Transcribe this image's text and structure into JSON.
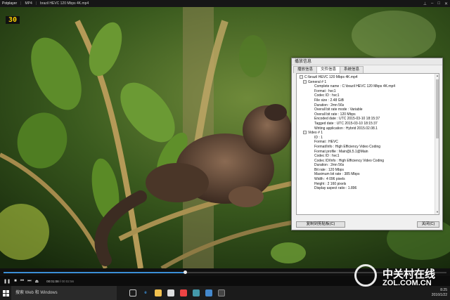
{
  "player": {
    "logo": "Potplayer",
    "format": "MP4",
    "file_title": "brazil HEVC 120 Mbps 4K.mp4",
    "fps_overlay": "30"
  },
  "dialog": {
    "title": "播放信息",
    "tabs": [
      {
        "label": "播放信息",
        "active": false
      },
      {
        "label": "文件信息",
        "active": true
      },
      {
        "label": "系统信息",
        "active": false
      }
    ],
    "root": "C:\\brazil HEVC 120 Mbps 4K.mp4",
    "general_header": "General # 1",
    "general": [
      "Complete name : C:\\brazil HEVC 120 Mbps 4K.mp4",
      "Format : hvc1",
      "Codec ID : hvc1",
      "File size : 2.48 GiB",
      "Duration : 2mn 56s",
      "Overall bit rate mode : Variable",
      "Overall bit rate : 120 Mbps",
      "Encoded date : UTC 2015-03-10 18:15:37",
      "Tagged date : UTC 2015-03-10 18:15:37",
      "Writing application : Hybrid 2015.02.08.1"
    ],
    "video_header": "Video # 1",
    "video": [
      "ID : 1",
      "Format : HEVC",
      "Format/Info : High Efficiency Video Coding",
      "Format profile : Main@L5.1@Main",
      "Codec ID : hvc1",
      "Codec ID/Info : High Efficiency Video Coding",
      "Duration : 2mn 56s",
      "Bit rate : 120 Mbps",
      "Maximum bit rate : 385 Mbps",
      "Width : 4 096 pixels",
      "Height : 2 160 pixels",
      "Display aspect ratio : 1.896"
    ],
    "copy_button": "复制到剪贴板(C)",
    "close_button": "关闭(C)"
  },
  "playback": {
    "progress_fraction": 0.41,
    "time_current": "00:01:08",
    "time_total": "00:02:56",
    "accent": "#3b8ed6"
  },
  "taskbar": {
    "search_placeholder": "搜索 Web 和 Windows",
    "time": "8:25",
    "date": "2016/1/22",
    "icons": [
      "task-view-icon",
      "edge-icon",
      "explorer-icon",
      "store-icon",
      "app-icon",
      "app-icon",
      "app-icon",
      "potplayer-icon"
    ]
  },
  "watermark": {
    "cn": "中关村在线",
    "en": "ZOL.COM.CN"
  }
}
